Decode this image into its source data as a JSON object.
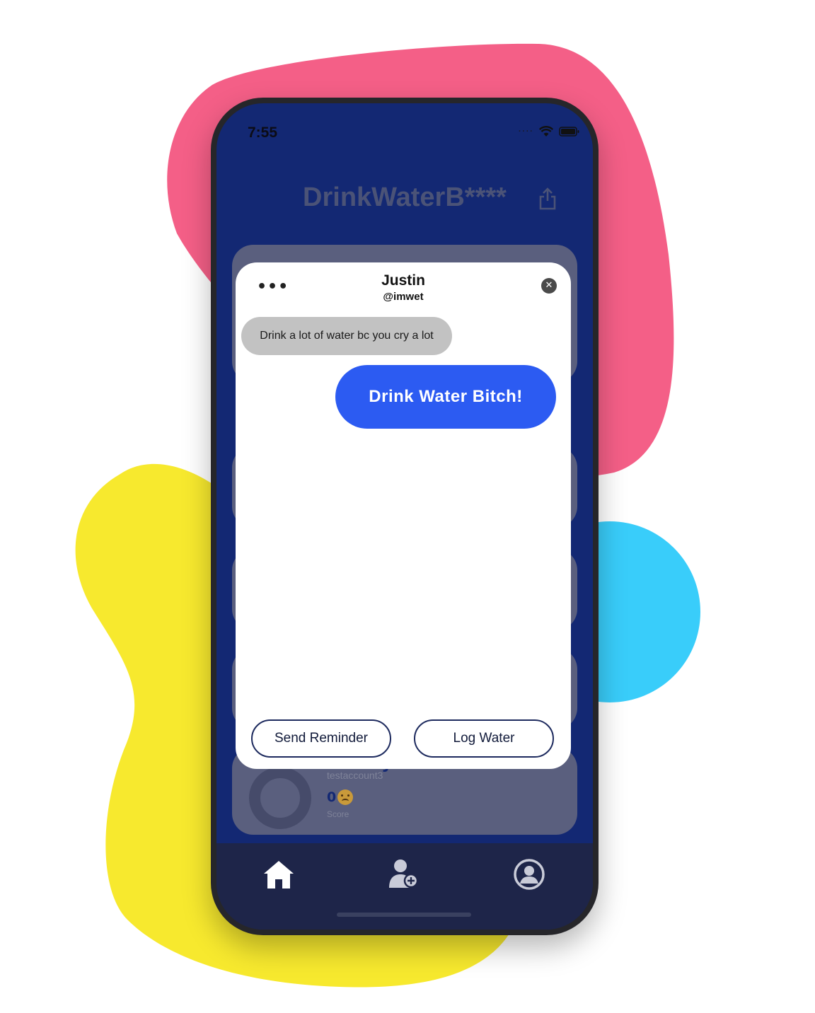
{
  "status_bar": {
    "time": "7:55"
  },
  "header": {
    "title": "DrinkWaterB****"
  },
  "background_card": {
    "name": "Larry",
    "username": "testaccount3",
    "score": "0",
    "score_label": "Score"
  },
  "modal": {
    "name": "Justin",
    "handle": "@imwet",
    "more_label": "•••",
    "close_label": "✕",
    "messages": {
      "received": "Drink a lot of water bc you cry a lot",
      "sent": "Drink Water Bitch!"
    },
    "send_reminder_label": "Send Reminder",
    "log_water_label": "Log Water"
  },
  "tabbar": {
    "items": [
      "home-icon",
      "add-friend-icon",
      "profile-icon"
    ]
  },
  "colors": {
    "pink_blob": "#f45f87",
    "yellow_blob": "#f7e92e",
    "blue_blob": "#39cdfa",
    "app_background": "#132873",
    "sent_bubble": "#2c5bf2",
    "received_bubble": "#c2c2c2",
    "tabbar": "#1e2549"
  }
}
